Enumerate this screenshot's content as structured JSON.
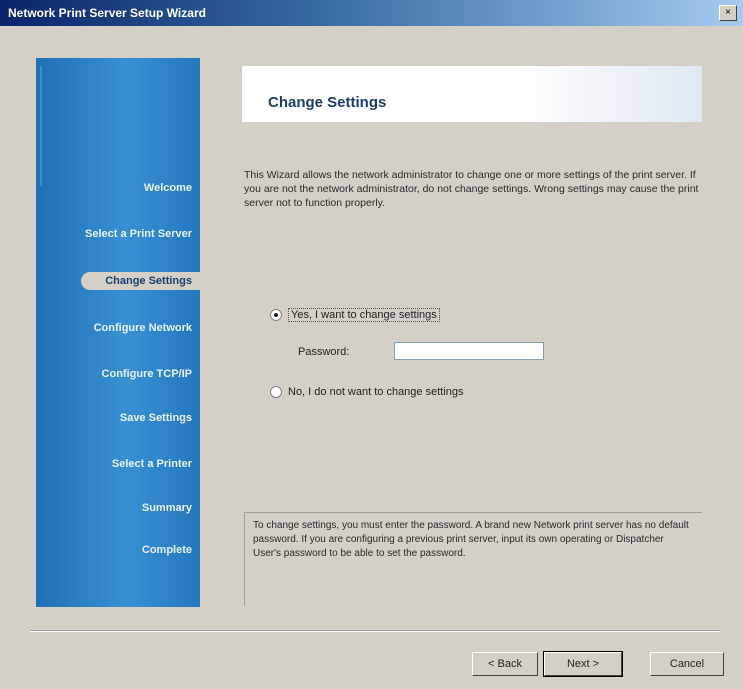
{
  "window": {
    "title": "Network Print Server Setup Wizard",
    "close_glyph": "×"
  },
  "sidebar": {
    "items": [
      {
        "label": "Welcome"
      },
      {
        "label": "Select a Print Server"
      },
      {
        "label": "Change Settings"
      },
      {
        "label": "Configure Network"
      },
      {
        "label": "Configure TCP/IP"
      },
      {
        "label": "Save Settings"
      },
      {
        "label": "Select a Printer"
      },
      {
        "label": "Summary"
      },
      {
        "label": "Complete"
      }
    ],
    "active_index": 2
  },
  "header": {
    "title": "Change Settings"
  },
  "main": {
    "description": "This Wizard allows the network administrator to change one or more settings of the print server. If you are not the network administrator, do not change settings. Wrong settings may cause the print server not to function properly.",
    "option_yes_label": "Yes, I want to change settings",
    "option_yes_selected": true,
    "password_label": "Password:",
    "password_value": "",
    "option_no_label": "No, I do not want to change settings",
    "note": "To change settings, you must enter the password. A brand new Network print server has no default password. If you are configuring a previous print server, input its own operating or Dispatcher User's password to be able to set the password."
  },
  "footer": {
    "back_label": "< Back",
    "next_label": "Next >",
    "cancel_label": "Cancel"
  }
}
